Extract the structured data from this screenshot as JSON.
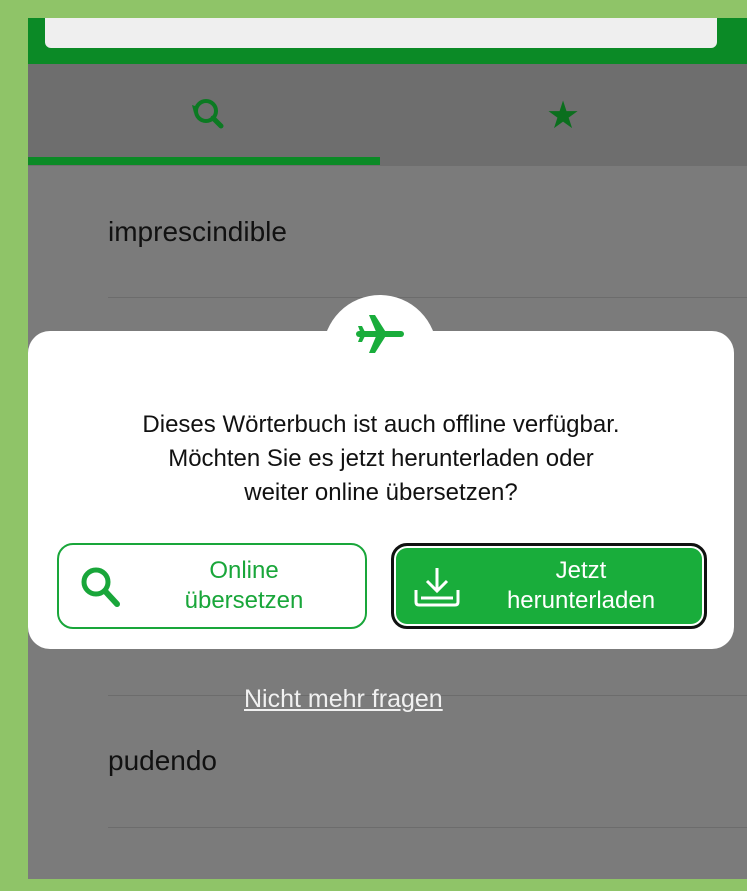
{
  "search": {
    "placeholder": ""
  },
  "tabs": [
    {
      "name": "history",
      "icon": "history-search-icon"
    },
    {
      "name": "favorites",
      "icon": "star-icon"
    }
  ],
  "list": {
    "items": [
      "imprescindible",
      "pudendo"
    ]
  },
  "dialog": {
    "icon": "airplane-icon",
    "message_line1": "Dieses Wörterbuch ist auch offline verfügbar.",
    "message_line2": "Möchten Sie es jetzt herunterladen oder",
    "message_line3": "weiter online übersetzen?",
    "online_button_line1": "Online",
    "online_button_line2": "übersetzen",
    "download_button_line1": "Jetzt",
    "download_button_line2": "herunterladen"
  },
  "dont_ask_again": "Nicht mehr fragen",
  "colors": {
    "accent": "#19ad3b",
    "header": "#0b8a26",
    "overlay": "#7b7b7b"
  }
}
